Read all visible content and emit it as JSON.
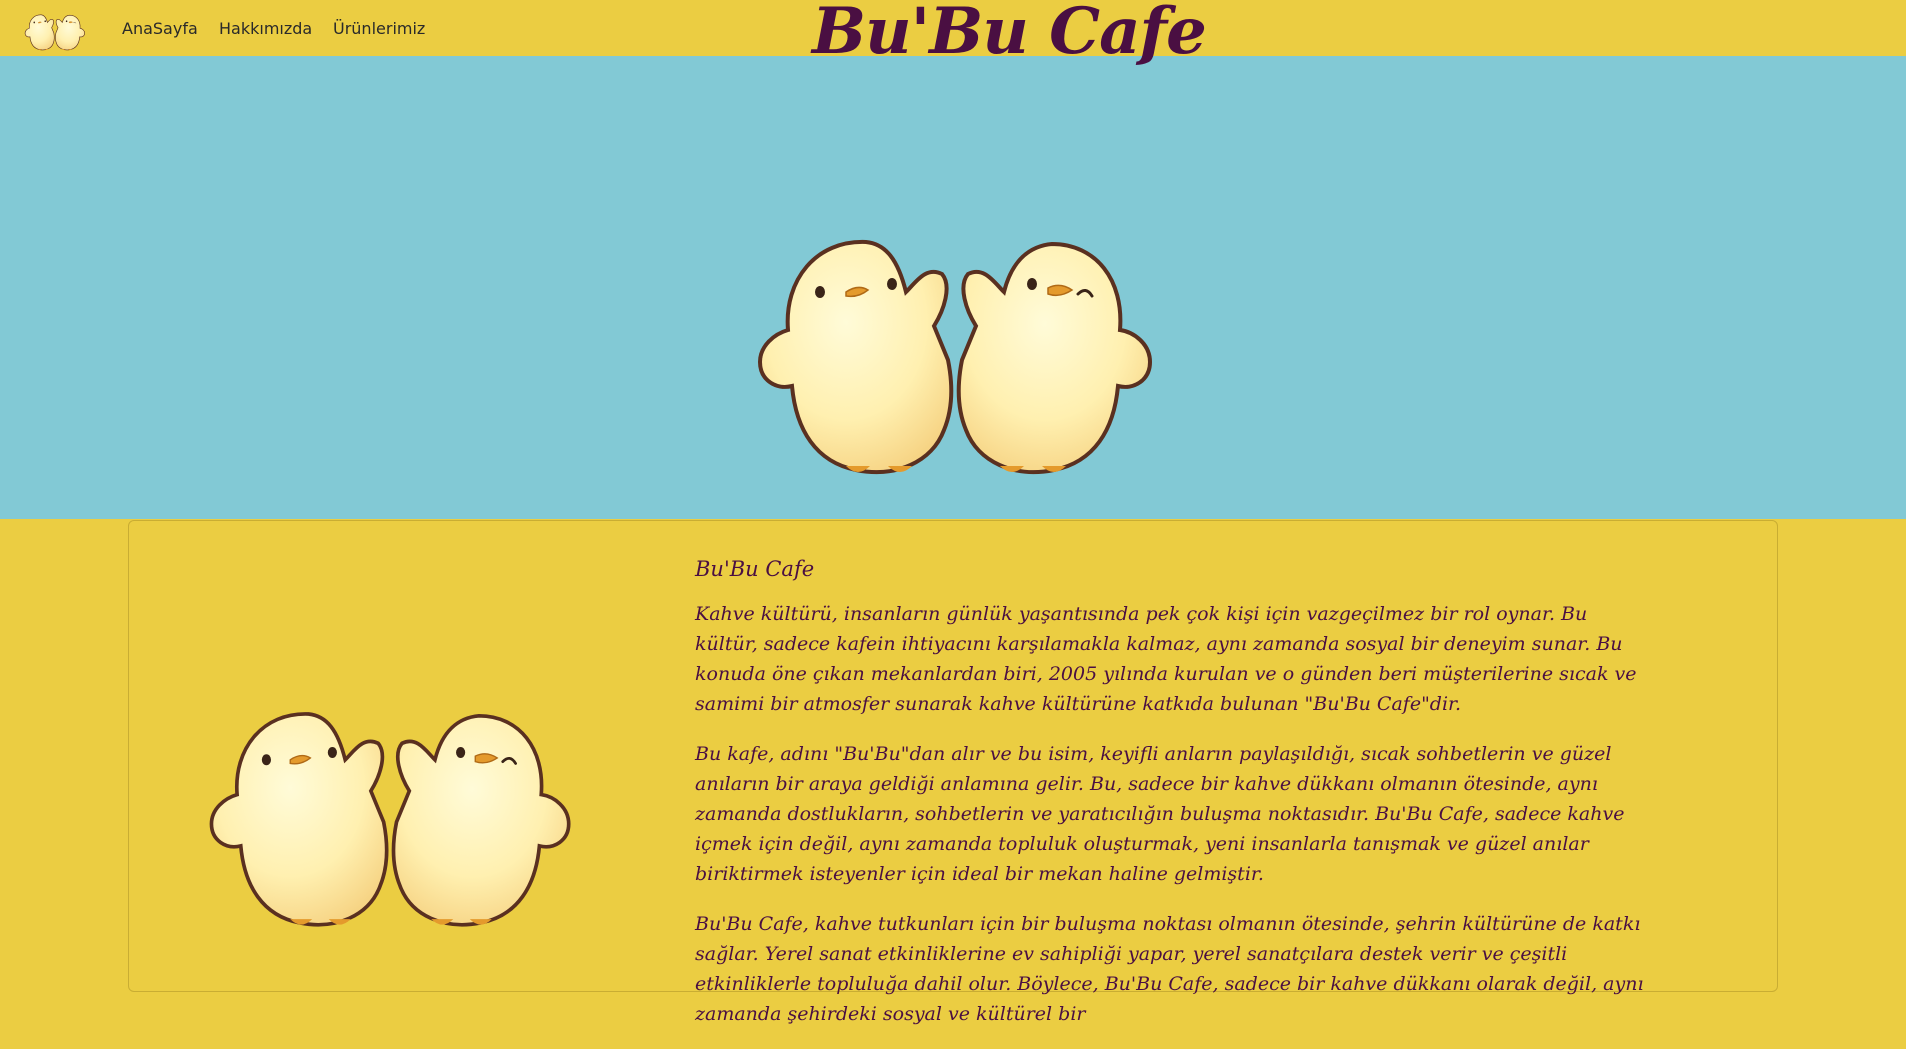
{
  "nav": {
    "logo_alt": "chicks-logo",
    "links": [
      "AnaSayfa",
      "Hakkımızda",
      "Ürünlerimiz"
    ],
    "brand": "Bu'Bu Cafe"
  },
  "hero": {
    "image": "two-chicks-illustration"
  },
  "about": {
    "title": "Bu'Bu Cafe",
    "paragraphs": [
      "Kahve kültürü, insanların günlük yaşantısında pek çok kişi için vazgeçilmez bir rol oynar. Bu kültür, sadece kafein ihtiyacını karşılamakla kalmaz, aynı zamanda sosyal bir deneyim sunar. Bu konuda öne çıkan mekanlardan biri, 2005 yılında kurulan ve o günden beri müşterilerine sıcak ve samimi bir atmosfer sunarak kahve kültürüne katkıda bulunan \"Bu'Bu Cafe\"dir.",
      "Bu kafe, adını \"Bu'Bu\"dan alır ve bu isim, keyifli anların paylaşıldığı, sıcak sohbetlerin ve güzel anıların bir araya geldiği anlamına gelir. Bu, sadece bir kahve dükkanı olmanın ötesinde, aynı zamanda dostlukların, sohbetlerin ve yaratıcılığın buluşma noktasıdır. Bu'Bu Cafe, sadece kahve içmek için değil, aynı zamanda topluluk oluşturmak, yeni insanlarla tanışmak ve güzel anılar biriktirmek isteyenler için ideal bir mekan haline gelmiştir.",
      "Bu'Bu Cafe, kahve tutkunları için bir buluşma noktası olmanın ötesinde, şehrin kültürüne de katkı sağlar. Yerel sanat etkinliklerine ev sahipliği yapar, yerel sanatçılara destek verir ve çeşitli etkinliklerle topluluğa dahil olur. Böylece, Bu'Bu Cafe, sadece bir kahve dükkanı olarak değil, aynı zamanda şehirdeki sosyal ve kültürel bir"
    ]
  },
  "colors": {
    "navbar_bg": "#ebcd42",
    "hero_bg": "#82c9d5",
    "brand_text": "#4a0f42"
  }
}
